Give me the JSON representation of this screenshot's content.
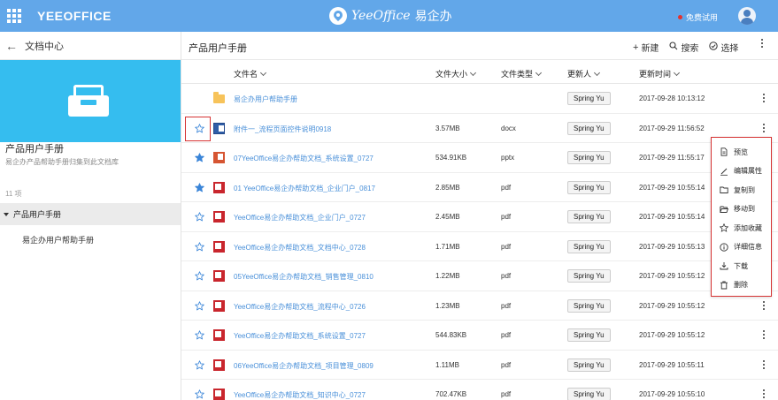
{
  "topbar": {
    "brand": "YEEOFFICE",
    "logo_text": "YeeOffice",
    "logo_cn": "易企办",
    "trial": "免费试用"
  },
  "left_panel": {
    "header": "文档中心",
    "title": "产品用户手册",
    "subtitle": "易企办产品帮助手册归集到此文档库",
    "count": "11 项",
    "tree_selected": "产品用户手册",
    "tree_child": "易企办用户帮助手册"
  },
  "main": {
    "title": "产品用户手册",
    "actions": {
      "new": "新建",
      "search": "搜索",
      "select": "选择"
    },
    "columns": {
      "name": "文件名",
      "size": "文件大小",
      "type": "文件类型",
      "updater": "更新人",
      "time": "更新时间"
    },
    "rows": [
      {
        "starred": false,
        "kind": "folder",
        "name": "易企办用户帮助手册",
        "size": "",
        "ext": "",
        "user": "Spring Yu",
        "time": "2017-09-28 10:13:12",
        "show_star": false
      },
      {
        "starred": false,
        "kind": "word",
        "name": "附件一_流程页面控件说明0918",
        "size": "3.57MB",
        "ext": "docx",
        "user": "Spring Yu",
        "time": "2017-09-29 11:56:52",
        "show_star": true
      },
      {
        "starred": true,
        "kind": "ppt",
        "name": "07YeeOffice易企办帮助文档_系统设置_0727",
        "size": "534.91KB",
        "ext": "pptx",
        "user": "Spring Yu",
        "time": "2017-09-29 11:55:17",
        "show_star": true
      },
      {
        "starred": true,
        "kind": "pdf",
        "name": "01 YeeOffice易企办帮助文档_企业门户_0817",
        "size": "2.85MB",
        "ext": "pdf",
        "user": "Spring Yu",
        "time": "2017-09-29 10:55:14",
        "show_star": true
      },
      {
        "starred": false,
        "kind": "pdf",
        "name": "YeeOffice易企办帮助文档_企业门户_0727",
        "size": "2.45MB",
        "ext": "pdf",
        "user": "Spring Yu",
        "time": "2017-09-29 10:55:14",
        "show_star": true
      },
      {
        "starred": false,
        "kind": "pdf",
        "name": "YeeOffice易企办帮助文档_文档中心_0728",
        "size": "1.71MB",
        "ext": "pdf",
        "user": "Spring Yu",
        "time": "2017-09-29 10:55:13",
        "show_star": true
      },
      {
        "starred": false,
        "kind": "pdf",
        "name": "05YeeOffice易企办帮助文档_销售管理_0810",
        "size": "1.22MB",
        "ext": "pdf",
        "user": "Spring Yu",
        "time": "2017-09-29 10:55:12",
        "show_star": true
      },
      {
        "starred": false,
        "kind": "pdf",
        "name": "YeeOffice易企办帮助文档_流程中心_0726",
        "size": "1.23MB",
        "ext": "pdf",
        "user": "Spring Yu",
        "time": "2017-09-29 10:55:12",
        "show_star": true
      },
      {
        "starred": false,
        "kind": "pdf",
        "name": "YeeOffice易企办帮助文档_系统设置_0727",
        "size": "544.83KB",
        "ext": "pdf",
        "user": "Spring Yu",
        "time": "2017-09-29 10:55:12",
        "show_star": true
      },
      {
        "starred": false,
        "kind": "pdf",
        "name": "06YeeOffice易企办帮助文档_项目管理_0809",
        "size": "1.11MB",
        "ext": "pdf",
        "user": "Spring Yu",
        "time": "2017-09-29 10:55:11",
        "show_star": true
      },
      {
        "starred": false,
        "kind": "pdf",
        "name": "YeeOffice易企办帮助文档_知识中心_0727",
        "size": "702.47KB",
        "ext": "pdf",
        "user": "Spring Yu",
        "time": "2017-09-29 10:55:10",
        "show_star": true
      }
    ]
  },
  "context_menu": {
    "items": [
      {
        "label": "预览",
        "icon": "file-icon"
      },
      {
        "label": "编辑属性",
        "icon": "pencil-icon"
      },
      {
        "label": "复制到",
        "icon": "folder-icon"
      },
      {
        "label": "移动到",
        "icon": "folder-open-icon"
      },
      {
        "label": "添加收藏",
        "icon": "star-icon"
      },
      {
        "label": "详细信息",
        "icon": "info-icon"
      },
      {
        "label": "下载",
        "icon": "download-icon"
      },
      {
        "label": "删除",
        "icon": "trash-icon"
      }
    ]
  },
  "colors": {
    "topbar": "#62a7e9",
    "banner": "#35bdef",
    "link": "#4a90d9",
    "star": "#3a85d8",
    "highlight": "#d63333"
  }
}
